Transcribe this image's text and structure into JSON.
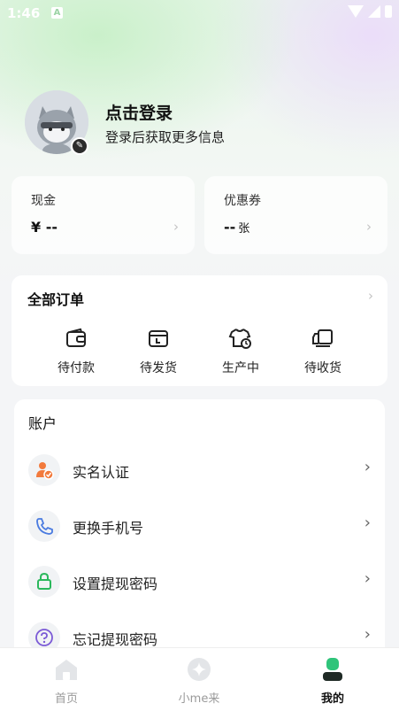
{
  "status_bar": {
    "time": "1:46",
    "notification_letter": "A"
  },
  "profile": {
    "login_title": "点击登录",
    "login_subtitle": "登录后获取更多信息"
  },
  "assets": {
    "cash": {
      "label": "现金",
      "currency": "¥",
      "value": "--"
    },
    "coupons": {
      "label": "优惠券",
      "value": "--",
      "unit": "张"
    }
  },
  "orders": {
    "title": "全部订单",
    "items": [
      {
        "label": "待付款",
        "icon": "wallet-icon"
      },
      {
        "label": "待发货",
        "icon": "package-icon"
      },
      {
        "label": "生产中",
        "icon": "tshirt-clock-icon"
      },
      {
        "label": "待收货",
        "icon": "truck-icon"
      }
    ]
  },
  "account": {
    "title": "账户",
    "items": [
      {
        "label": "实名认证",
        "icon": "user-verified-icon"
      },
      {
        "label": "更换手机号",
        "icon": "phone-icon"
      },
      {
        "label": "设置提现密码",
        "icon": "lock-icon"
      },
      {
        "label": "忘记提现密码",
        "icon": "question-icon"
      }
    ]
  },
  "bottom_nav": {
    "items": [
      {
        "label": "首页",
        "icon": "home-icon",
        "active": false
      },
      {
        "label": "小me来",
        "icon": "sparkle-icon",
        "active": false
      },
      {
        "label": "我的",
        "icon": "profile-icon",
        "active": true
      }
    ]
  },
  "colors": {
    "accent_green": "#2fc47a",
    "orange_icon": "#f27a3c",
    "blue_icon": "#4a7be0",
    "green_icon": "#2bb85c",
    "purple_icon": "#7b5ad6"
  }
}
